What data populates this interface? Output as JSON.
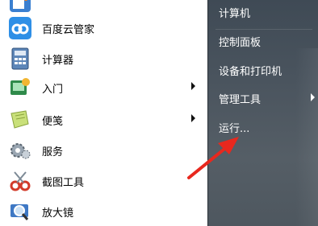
{
  "left_menu": {
    "items": [
      {
        "label": "百度云管家",
        "icon": "baidu-cloud-icon",
        "has_submenu": false
      },
      {
        "label": "计算器",
        "icon": "calculator-icon",
        "has_submenu": false
      },
      {
        "label": "入门",
        "icon": "getting-started-icon",
        "has_submenu": true
      },
      {
        "label": "便笺",
        "icon": "sticky-notes-icon",
        "has_submenu": true
      },
      {
        "label": "服务",
        "icon": "services-gear-icon",
        "has_submenu": false
      },
      {
        "label": "截图工具",
        "icon": "snipping-tool-icon",
        "has_submenu": false
      },
      {
        "label": "放大镜",
        "icon": "magnifier-icon",
        "has_submenu": false
      }
    ]
  },
  "right_menu": {
    "items": [
      {
        "label": "计算机",
        "has_submenu": false
      },
      {
        "label": "控制面板",
        "has_submenu": false
      },
      {
        "label": "设备和打印机",
        "has_submenu": false
      },
      {
        "label": "管理工具",
        "has_submenu": true
      },
      {
        "label": "运行...",
        "has_submenu": false
      }
    ]
  },
  "annotation": {
    "arrow_color": "#e8281e",
    "target": "运行..."
  }
}
